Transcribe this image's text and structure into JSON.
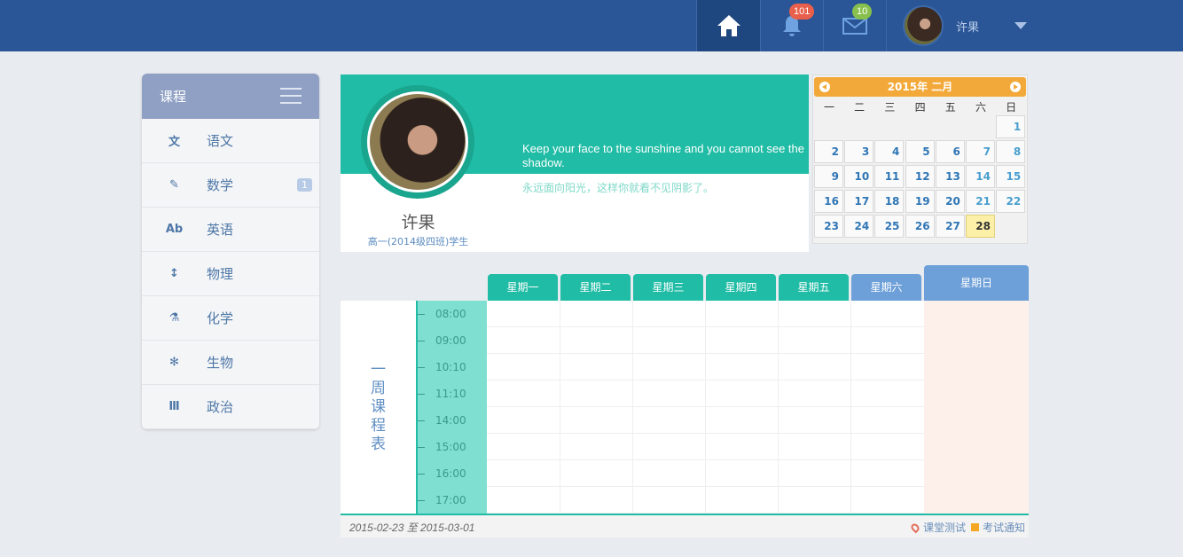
{
  "topbar": {
    "notifications_count": "101",
    "messages_count": "10",
    "user_name": "许果",
    "colors": {
      "bg": "#2a5596",
      "active": "#1e4780"
    }
  },
  "sidebar": {
    "title": "课程",
    "items": [
      {
        "icon": "文",
        "label": "语文"
      },
      {
        "icon": "✎",
        "label": "数学",
        "count": "1"
      },
      {
        "icon": "Ab",
        "label": "英语"
      },
      {
        "icon": "↕",
        "label": "物理"
      },
      {
        "icon": "⚗",
        "label": "化学"
      },
      {
        "icon": "✻",
        "label": "生物"
      },
      {
        "icon": "Ⅲ",
        "label": "政治"
      }
    ]
  },
  "profile": {
    "name": "许果",
    "class": "高一(2014级四班)学生",
    "quote_en": "Keep your face to the sunshine and you cannot see the shadow.",
    "quote_cn": "永远面向阳光，这样你就看不见阴影了。",
    "accent": "#20bca5"
  },
  "calendar": {
    "title": "2015年 二月",
    "weekdays": [
      "一",
      "二",
      "三",
      "四",
      "五",
      "六",
      "日"
    ],
    "today": 28,
    "rows": [
      [
        null,
        null,
        null,
        null,
        null,
        null,
        1
      ],
      [
        2,
        3,
        4,
        5,
        6,
        7,
        8
      ],
      [
        9,
        10,
        11,
        12,
        13,
        14,
        15
      ],
      [
        16,
        17,
        18,
        19,
        20,
        21,
        22
      ],
      [
        23,
        24,
        25,
        26,
        27,
        28,
        null
      ]
    ],
    "header_color": "#f3a93a"
  },
  "timetable": {
    "label": "一周课程表",
    "days": [
      "星期一",
      "星期二",
      "星期三",
      "星期四",
      "星期五",
      "星期六",
      "星期日"
    ],
    "times": [
      "08:00",
      "09:00",
      "10:10",
      "11:10",
      "14:00",
      "15:00",
      "16:00",
      "17:00"
    ],
    "date_range": "2015-02-23 至 2015-03-01",
    "legend": {
      "test": "课堂测试",
      "exam": "考试通知"
    }
  }
}
